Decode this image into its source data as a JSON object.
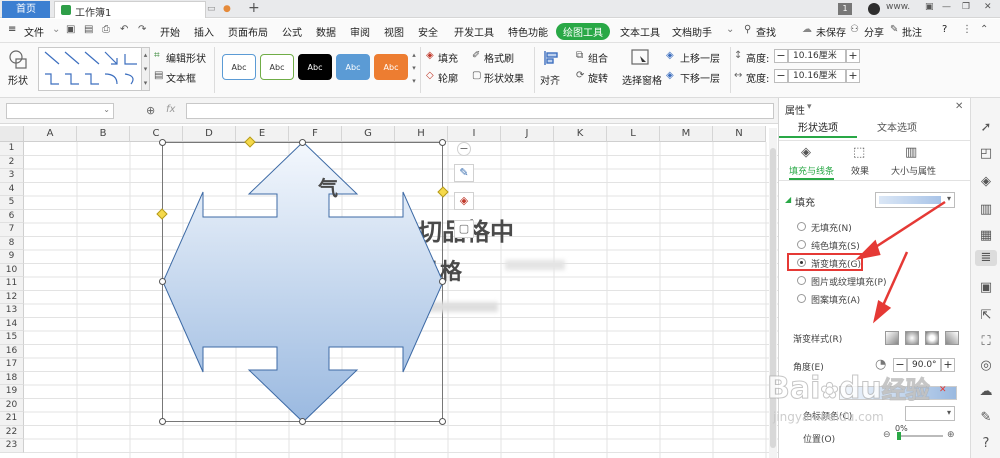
{
  "titlebar": {
    "home_tab": "首页",
    "doc_tab": "工作簿1",
    "new_tab": "+",
    "page_badge": "1",
    "user": "www."
  },
  "menubar": {
    "file": "文件",
    "items": [
      "开始",
      "插入",
      "页面布局",
      "公式",
      "数据",
      "审阅",
      "视图",
      "安全",
      "开发工具",
      "特色功能",
      "绘图工具",
      "文本工具",
      "文档助手"
    ],
    "active_item": "绘图工具",
    "search": "查找",
    "unsaved": "未保存",
    "share": "分享",
    "comment": "批注",
    "help": "?"
  },
  "ribbon": {
    "shape": "形状",
    "edit_shape": "编辑形状",
    "textbox": "文本框",
    "style_label": "Abc",
    "fill": "填充",
    "format_brush": "格式刷",
    "outline": "轮廓",
    "shape_effect": "形状效果",
    "align": "对齐",
    "group": "组合",
    "rotate": "旋转",
    "selection_pane": "选择窗格",
    "bring_forward": "上移一层",
    "send_backward": "下移一层",
    "height_label": "高度:",
    "height_value": "10.16厘米",
    "width_label": "宽度:",
    "width_value": "10.16厘米",
    "style_colors": [
      "#ffffff",
      "#ffffff",
      "#000000",
      "#5b9bd5",
      "#ed7d31"
    ],
    "style_borders": [
      "#5b9bd5",
      "#70ad47",
      "#000000",
      "#5b9bd5",
      "#ed7d31"
    ]
  },
  "formula": {
    "fx": "fx"
  },
  "grid": {
    "columns": [
      "A",
      "B",
      "C",
      "D",
      "E",
      "F",
      "G",
      "H",
      "I",
      "J",
      "K",
      "L",
      "M",
      "N"
    ],
    "rows": [
      "1",
      "2",
      "3",
      "4",
      "5",
      "6",
      "7",
      "8",
      "9",
      "10",
      "11",
      "12",
      "13",
      "14",
      "15",
      "16",
      "17",
      "18",
      "19",
      "20",
      "21",
      "22",
      "23"
    ],
    "overlay_text": [
      "气",
      "类一切品格中",
      "品格"
    ]
  },
  "panel": {
    "title": "属性",
    "tab_shape": "形状选项",
    "tab_text": "文本选项",
    "sub_fill_line": "填充与线条",
    "sub_effect": "效果",
    "sub_size": "大小与属性",
    "section_fill": "填充",
    "fill_options": [
      "无填充(N)",
      "纯色填充(S)",
      "渐变填充(G)",
      "图片或纹理填充(P)",
      "图案填充(A)"
    ],
    "selected_fill": "渐变填充(G)",
    "gradient_style": "渐变样式(R)",
    "angle_label": "角度(E)",
    "angle_value": "90.0°",
    "stop_color": "色标颜色(C)",
    "position_label": "位置(O)",
    "position_value": "0%",
    "annotation_color": "#e53935"
  },
  "watermark": {
    "brand": "Bai",
    "brand2": "du",
    "brand3": "经验",
    "url": "jingyan.baidu.com"
  }
}
